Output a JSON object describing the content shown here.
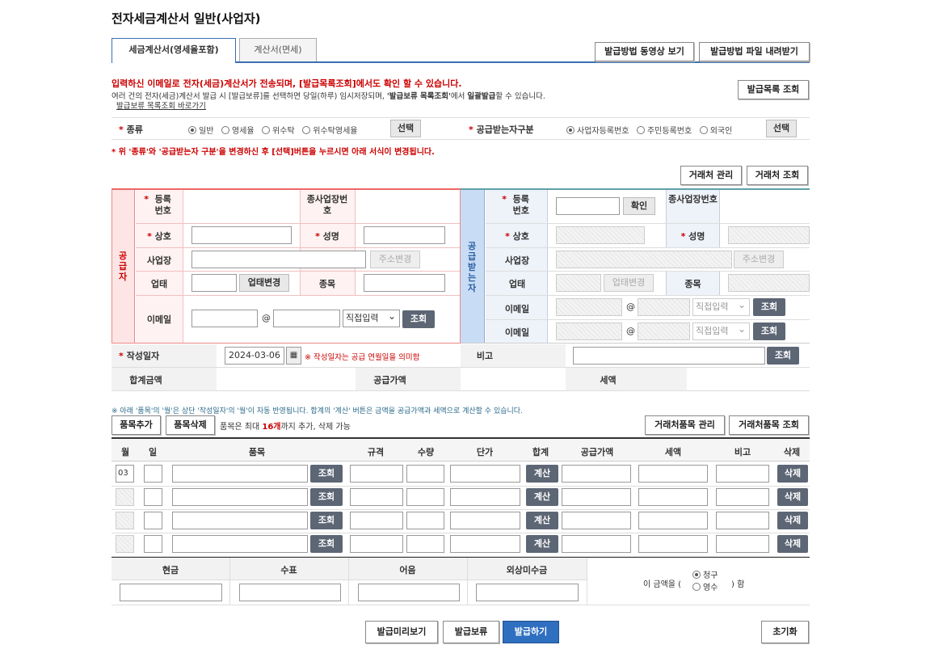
{
  "page_title": "전자세금계산서 일반(사업자)",
  "tabs": [
    {
      "label": "세금계산서(영세율포함)"
    },
    {
      "label": "계산서(면세)"
    }
  ],
  "top_buttons": {
    "video": "발급방법 동영상 보기",
    "file": "발급방법 파일 내려받기",
    "issue_list": "발급목록 조회"
  },
  "notice": {
    "line1": "입력하신 이메일로 전자(세금)계산서가 전송되며, [발급목록조회]에서도 확인 할 수 있습니다.",
    "line2a": "여러 건의 전자(세금)계산서 발급 시 [발급보류]를 선택하면 당일(하루) 임시저장되며, ",
    "line2b": "'발급보류 목록조회'",
    "line2c": "에서 ",
    "line2d": "일괄발급",
    "line2e": "할 수 있습니다.",
    "link": "발급보류 목록조회 바로가기",
    "change_warning": "* 위 '종류'와 '공급받는자 구분'을 변경하신 후 [선택]버튼을 누르시면 아래 서식이 변경됩니다."
  },
  "kind": {
    "label": "종류",
    "options": [
      "일반",
      "영세율",
      "위수탁",
      "위수탁영세율"
    ],
    "selected": "일반",
    "select_btn": "선택"
  },
  "receiver_type": {
    "label": "공급받는자구분",
    "options": [
      "사업자등록번호",
      "주민등록번호",
      "외국인"
    ],
    "selected": "사업자등록번호",
    "select_btn": "선택"
  },
  "partner_buttons": {
    "manage": "거래처 관리",
    "lookup": "거래처 조회"
  },
  "supplier": {
    "side_label": "공급자",
    "reg_no": "등록번호",
    "branch_no": "종사업장번호",
    "company": "상호",
    "name": "성명",
    "address": "사업장",
    "address_value": "",
    "addr_change": "주소변경",
    "biz_type": "업태",
    "biz_type_value": "",
    "biz_change": "업태변경",
    "biz_item": "종목",
    "email": "이메일",
    "email_at": "@",
    "email_domain_select": "직접입력",
    "lookup": "조회"
  },
  "receiver": {
    "side_label": "공급받는자",
    "reg_no": "등록번호",
    "confirm": "확인",
    "branch_no": "종사업장번호",
    "company": "상호",
    "name": "성명",
    "address": "사업장",
    "addr_change": "주소변경",
    "biz_type": "업태",
    "biz_change": "업태변경",
    "biz_item": "종목",
    "email": "이메일",
    "email_at": "@",
    "email_domain_select": "직접입력",
    "lookup": "조회"
  },
  "date_row": {
    "label": "작성일자",
    "value": "2024-03-06",
    "note": "※ 작성일자는 공급 연월일을 의미함",
    "remark": "비고",
    "lookup": "조회"
  },
  "totals": {
    "total": "합계금액",
    "supply": "공급가액",
    "tax": "세액"
  },
  "item_notice": "※ 아래 '품목'의 '월'은 상단 '작성일자'의 '월'이 자동 반영됩니다. 합계의 '계산' 버튼은 금액을 공급가액과 세액으로 계산할 수 있습니다.",
  "item_buttons": {
    "add": "품목추가",
    "delete": "품목삭제",
    "limit_a": "품목은 최대 ",
    "limit_b": "16개",
    "limit_c": "까지 추가, 삭제 가능",
    "manage": "거래처품목 관리",
    "lookup": "거래처품목 조회"
  },
  "item_headers": [
    "월",
    "일",
    "품목",
    "규격",
    "수량",
    "단가",
    "합계",
    "공급가액",
    "세액",
    "비고",
    "삭제"
  ],
  "item_rows": [
    {
      "month": "03",
      "lookup": "조회",
      "calc": "계산",
      "del": "삭제"
    },
    {
      "month": "",
      "lookup": "조회",
      "calc": "계산",
      "del": "삭제"
    },
    {
      "month": "",
      "lookup": "조회",
      "calc": "계산",
      "del": "삭제"
    },
    {
      "month": "",
      "lookup": "조회",
      "calc": "계산",
      "del": "삭제"
    }
  ],
  "payment": {
    "headers": [
      "현금",
      "수표",
      "어음",
      "외상미수금"
    ],
    "sentence_a": "이 금액을 (",
    "sentence_b": ") 함",
    "claim": "청구",
    "receipt": "영수",
    "selected": "청구"
  },
  "bottom_buttons": {
    "preview": "발급미리보기",
    "hold": "발급보류",
    "issue": "발급하기",
    "reset": "초기화"
  }
}
